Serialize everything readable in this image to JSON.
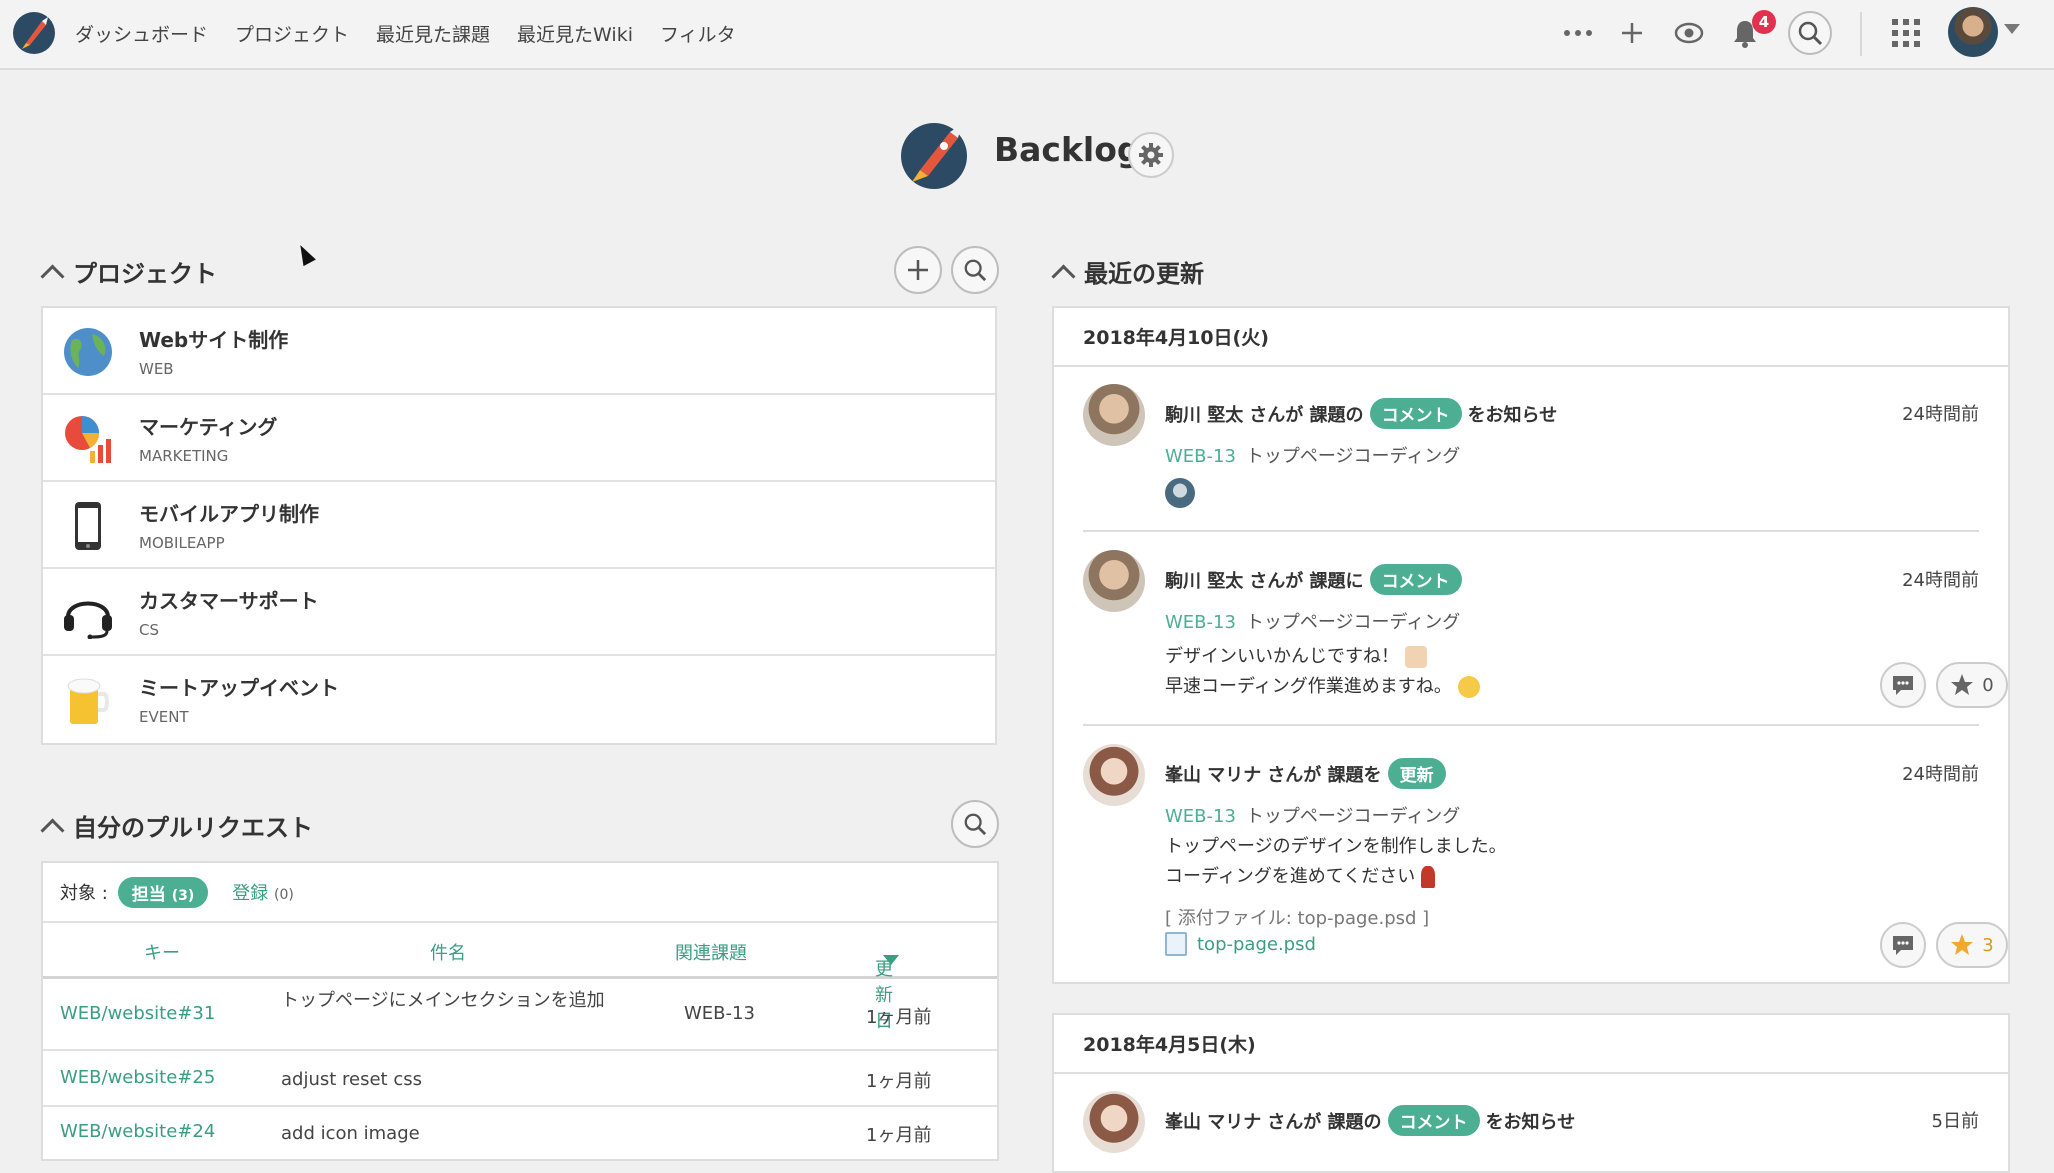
{
  "header": {
    "nav": [
      "ダッシュボード",
      "プロジェクト",
      "最近見た課題",
      "最近見たWiki",
      "フィルタ"
    ],
    "notification_count": "4"
  },
  "space": {
    "name": "Backlog"
  },
  "projects": {
    "title": "プロジェクト",
    "items": [
      {
        "name": "Webサイト制作",
        "key": "WEB",
        "icon": "globe-icon"
      },
      {
        "name": "マーケティング",
        "key": "MARKETING",
        "icon": "pie-chart-icon"
      },
      {
        "name": "モバイルアプリ制作",
        "key": "MOBILEAPP",
        "icon": "smartphone-icon"
      },
      {
        "name": "カスタマーサポート",
        "key": "CS",
        "icon": "headset-icon"
      },
      {
        "name": "ミートアップイベント",
        "key": "EVENT",
        "icon": "beer-icon"
      }
    ]
  },
  "pull_requests": {
    "title": "自分のプルリクエスト",
    "filter_label": "対象 :",
    "assigned_label": "担当",
    "assigned_count": "(3)",
    "registered_label": "登録",
    "registered_count": "(0)",
    "columns": {
      "key": "キー",
      "subject": "件名",
      "issue": "関連課題",
      "updated": "更新日"
    },
    "rows": [
      {
        "key": "WEB/website#31",
        "subject": "トップページにメインセクションを追加",
        "issue": "WEB-13",
        "updated": "1ヶ月前"
      },
      {
        "key": "WEB/website#25",
        "subject": "adjust reset css",
        "issue": "",
        "updated": "1ヶ月前"
      },
      {
        "key": "WEB/website#24",
        "subject": "add icon image",
        "issue": "",
        "updated": "1ヶ月前"
      }
    ]
  },
  "updates": {
    "title": "最近の更新",
    "groups": [
      {
        "date": "2018年4月10日(火)",
        "entries": [
          {
            "user": "駒川 堅太",
            "action_pre": "さんが 課題の",
            "tag": "コメント",
            "action_post": "をお知らせ",
            "time": "24時間前",
            "issue_key": "WEB-13",
            "issue_title": "トップページコーディング"
          },
          {
            "user": "駒川 堅太",
            "action_pre": "さんが 課題に",
            "tag": "コメント",
            "action_post": "",
            "time": "24時間前",
            "issue_key": "WEB-13",
            "issue_title": "トップページコーディング",
            "text1": "デザインいいかんじですね！",
            "text2": "早速コーディング作業進めますね。",
            "stars": "0"
          },
          {
            "user": "峯山 マリナ",
            "action_pre": "さんが 課題を",
            "tag": "更新",
            "action_post": "",
            "time": "24時間前",
            "issue_key": "WEB-13",
            "issue_title": "トップページコーディング",
            "text1": "トップページのデザインを制作しました。",
            "text2": "コーディングを進めてください",
            "attach_label": "[ 添付ファイル: top-page.psd ]",
            "file": "top-page.psd",
            "stars": "3"
          }
        ]
      },
      {
        "date": "2018年4月5日(木)",
        "entries": [
          {
            "user": "峯山 マリナ",
            "action_pre": "さんが 課題の",
            "tag": "コメント",
            "action_post": "をお知らせ",
            "time": "5日前"
          }
        ]
      }
    ]
  },
  "colors": {
    "accent": "#4caf93",
    "badge": "#e0324f"
  }
}
